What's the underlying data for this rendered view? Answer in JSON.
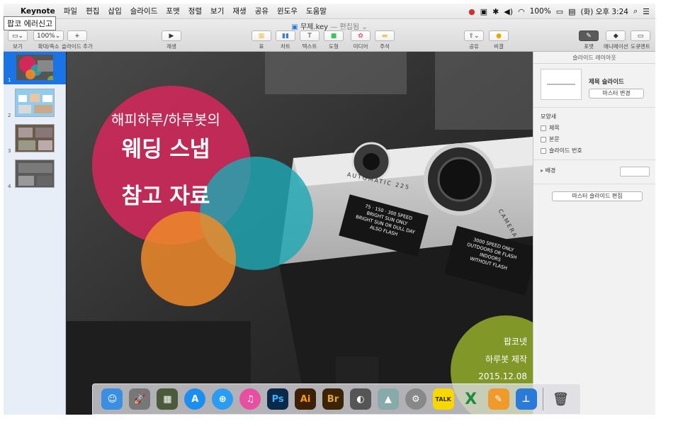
{
  "menubar": {
    "apple": "",
    "app_name": "Keynote",
    "items": [
      "파일",
      "편집",
      "삽입",
      "슬라이드",
      "포맷",
      "정렬",
      "보기",
      "재생",
      "공유",
      "윈도우",
      "도움말"
    ],
    "status": {
      "battery": "100%",
      "clock": "(화) 오후 3:24"
    }
  },
  "tooltip": "팝코 에러신고",
  "document": {
    "title": "무제.key",
    "separator": "—",
    "state": "편집됨"
  },
  "toolbar": {
    "view": {
      "label": "보기"
    },
    "zoom": {
      "value": "100%",
      "label": "확대/축소"
    },
    "add_slide": {
      "label": "슬라이드 추가"
    },
    "play": {
      "label": "재생"
    },
    "insert": [
      {
        "label": "표",
        "color": "#f5c443"
      },
      {
        "label": "차트",
        "color": "#3a7bd5"
      },
      {
        "label": "텍스트",
        "glyph": "T"
      },
      {
        "label": "도형",
        "color": "#3cc45a"
      },
      {
        "label": "미디어",
        "color": "#e0507a"
      },
      {
        "label": "주석",
        "color": "#f5c443"
      }
    ],
    "share": {
      "label": "공유"
    },
    "tips": {
      "label": "비결"
    },
    "format": {
      "label": "포맷"
    },
    "animate": {
      "label": "애니메이션"
    },
    "document": {
      "label": "도큐멘트"
    }
  },
  "navigator": {
    "slides": [
      {
        "num": "1",
        "selected": true
      },
      {
        "num": "2"
      },
      {
        "num": "3"
      },
      {
        "num": "4"
      }
    ]
  },
  "slide": {
    "title_line1": "해피하루/하루봇의",
    "title_line2": "웨딩 스냅",
    "title_line3": "참고 자료",
    "author_line1": "팝코넷",
    "author_line2": "하루봇 제작",
    "date": "2015.12.08",
    "camera_text": {
      "brand": "AUTOMATIC 225",
      "speed1": "75 · 150 · 300 SPEED",
      "speed1b": "BRIGHT SUN ONLY",
      "speed1c": "BRIGHT SUN OR DULL DAY",
      "speed1d": "ALSO FLASH",
      "speed2": "3000 SPEED ONLY",
      "speed2b": "OUTDOORS OR FLASH",
      "speed2c": "INDOORS",
      "speed2d": "WITHOUT FLASH",
      "camera_label": "CAMERA"
    },
    "colors": {
      "pink": "#d2285a",
      "orange": "#ef8a2a",
      "teal": "#1fa8b3",
      "olive": "#8aa229"
    }
  },
  "inspector": {
    "header": "슬라이드 레이아웃",
    "layout_name": "제목 슬라이드",
    "master_change": "마스터 변경",
    "appearance": "모양새",
    "options": [
      "제목",
      "본문",
      "슬라이드 번호"
    ],
    "background": "배경",
    "edit_master": "마스터 슬라이드 편집"
  },
  "dock": {
    "items": [
      {
        "name": "finder",
        "color": "#3a8fe5",
        "glyph": "☺"
      },
      {
        "name": "launchpad",
        "color": "#777",
        "glyph": "🚀"
      },
      {
        "name": "mission-control",
        "color": "#4a5a3a",
        "glyph": "▦"
      },
      {
        "name": "app-store",
        "color": "#1c8ef0",
        "glyph": "A"
      },
      {
        "name": "safari",
        "color": "#2a9cf2",
        "glyph": "⊕"
      },
      {
        "name": "itunes",
        "color": "#e84fa0",
        "glyph": "♫"
      },
      {
        "name": "photoshop",
        "color": "#0b2a4a",
        "glyph": "Ps"
      },
      {
        "name": "illustrator",
        "color": "#3b1f06",
        "glyph": "Ai"
      },
      {
        "name": "bridge",
        "color": "#3b2406",
        "glyph": "Br"
      },
      {
        "name": "lightroom",
        "color": "#555",
        "glyph": "◐"
      },
      {
        "name": "preview",
        "color": "#8aa",
        "glyph": "▲"
      },
      {
        "name": "system-preferences",
        "color": "#888",
        "glyph": "⚙"
      },
      {
        "name": "kakaotalk",
        "color": "#f6d800",
        "glyph": "TALK"
      },
      {
        "name": "excel",
        "color": "#1c8c3c",
        "glyph": "X"
      },
      {
        "name": "pages",
        "color": "#ef9a2a",
        "glyph": "✎"
      },
      {
        "name": "keynote",
        "color": "#2a7ad8",
        "glyph": "⊥"
      },
      {
        "name": "trash",
        "color": "#bbb",
        "glyph": "🗑"
      }
    ]
  }
}
